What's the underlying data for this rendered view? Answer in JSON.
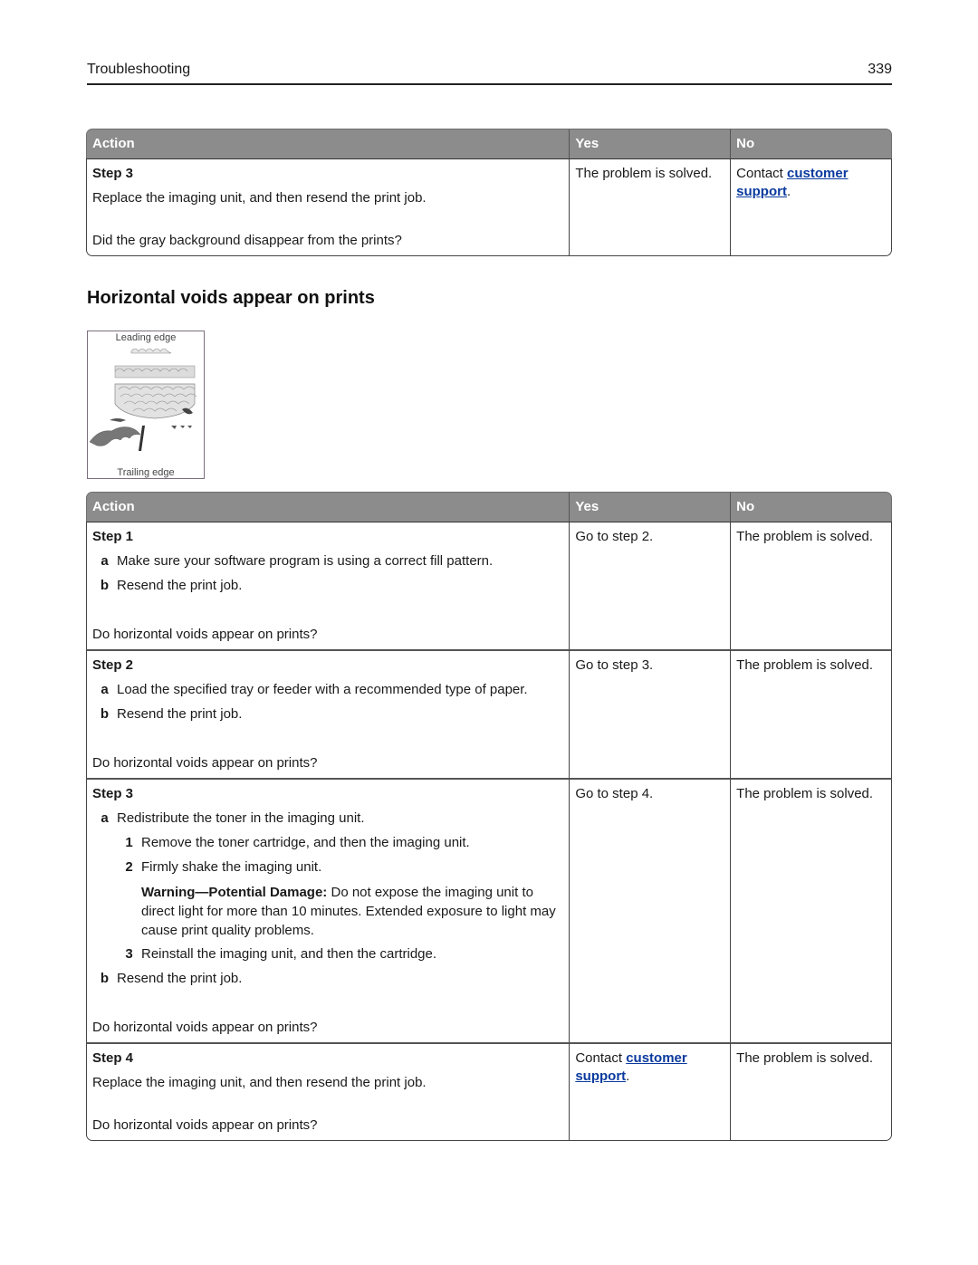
{
  "header": {
    "section": "Troubleshooting",
    "page_number": "339"
  },
  "table_top": {
    "columns": [
      "Action",
      "Yes",
      "No"
    ],
    "rows": [
      {
        "step": "Step 3",
        "instruction": "Replace the imaging unit, and then resend the print job.",
        "question": "Did the gray background disappear from the prints?",
        "yes": "The problem is solved.",
        "no": {
          "prefix": "Contact ",
          "link": "customer support",
          "suffix": "."
        }
      }
    ]
  },
  "section": {
    "title": "Horizontal voids appear on prints",
    "figure": {
      "top_caption": "Leading edge",
      "bottom_caption": "Trailing edge"
    }
  },
  "table_main": {
    "columns": [
      "Action",
      "Yes",
      "No"
    ],
    "rows": [
      {
        "step": "Step 1",
        "items": [
          {
            "mark": "a",
            "text": "Make sure your software program is using a correct fill pattern."
          },
          {
            "mark": "b",
            "text": "Resend the print job."
          }
        ],
        "question": "Do horizontal voids appear on prints?",
        "yes": "Go to step 2.",
        "no": "The problem is solved."
      },
      {
        "step": "Step 2",
        "items": [
          {
            "mark": "a",
            "text": "Load the specified tray or feeder with a recommended type of paper."
          },
          {
            "mark": "b",
            "text": "Resend the print job."
          }
        ],
        "question": "Do horizontal voids appear on prints?",
        "yes": "Go to step 3.",
        "no": "The problem is solved."
      },
      {
        "step": "Step 3",
        "item_a": "Redistribute the toner in the imaging unit.",
        "mark_a": "a",
        "subitems": [
          {
            "mark": "1",
            "text": "Remove the toner cartridge, and then the imaging unit."
          },
          {
            "mark": "2",
            "text": "Firmly shake the imaging unit."
          },
          {
            "mark": "3",
            "text": "Reinstall the imaging unit, and then the cartridge."
          }
        ],
        "warning_label": "Warning—Potential Damage:",
        "warning_text": " Do not expose the imaging unit to direct light for more than 10 minutes. Extended exposure to light may cause print quality problems.",
        "mark_b": "b",
        "item_b": "Resend the print job.",
        "question": "Do horizontal voids appear on prints?",
        "yes": "Go to step 4.",
        "no": "The problem is solved."
      },
      {
        "step": "Step 4",
        "instruction": "Replace the imaging unit, and then resend the print job.",
        "question": "Do horizontal voids appear on prints?",
        "yes": {
          "prefix": "Contact ",
          "link": "customer support",
          "suffix": "."
        },
        "no": "The problem is solved."
      }
    ]
  },
  "colors": {
    "table_header_bg": "#8c8c8c",
    "link": "#0b3a9e"
  }
}
